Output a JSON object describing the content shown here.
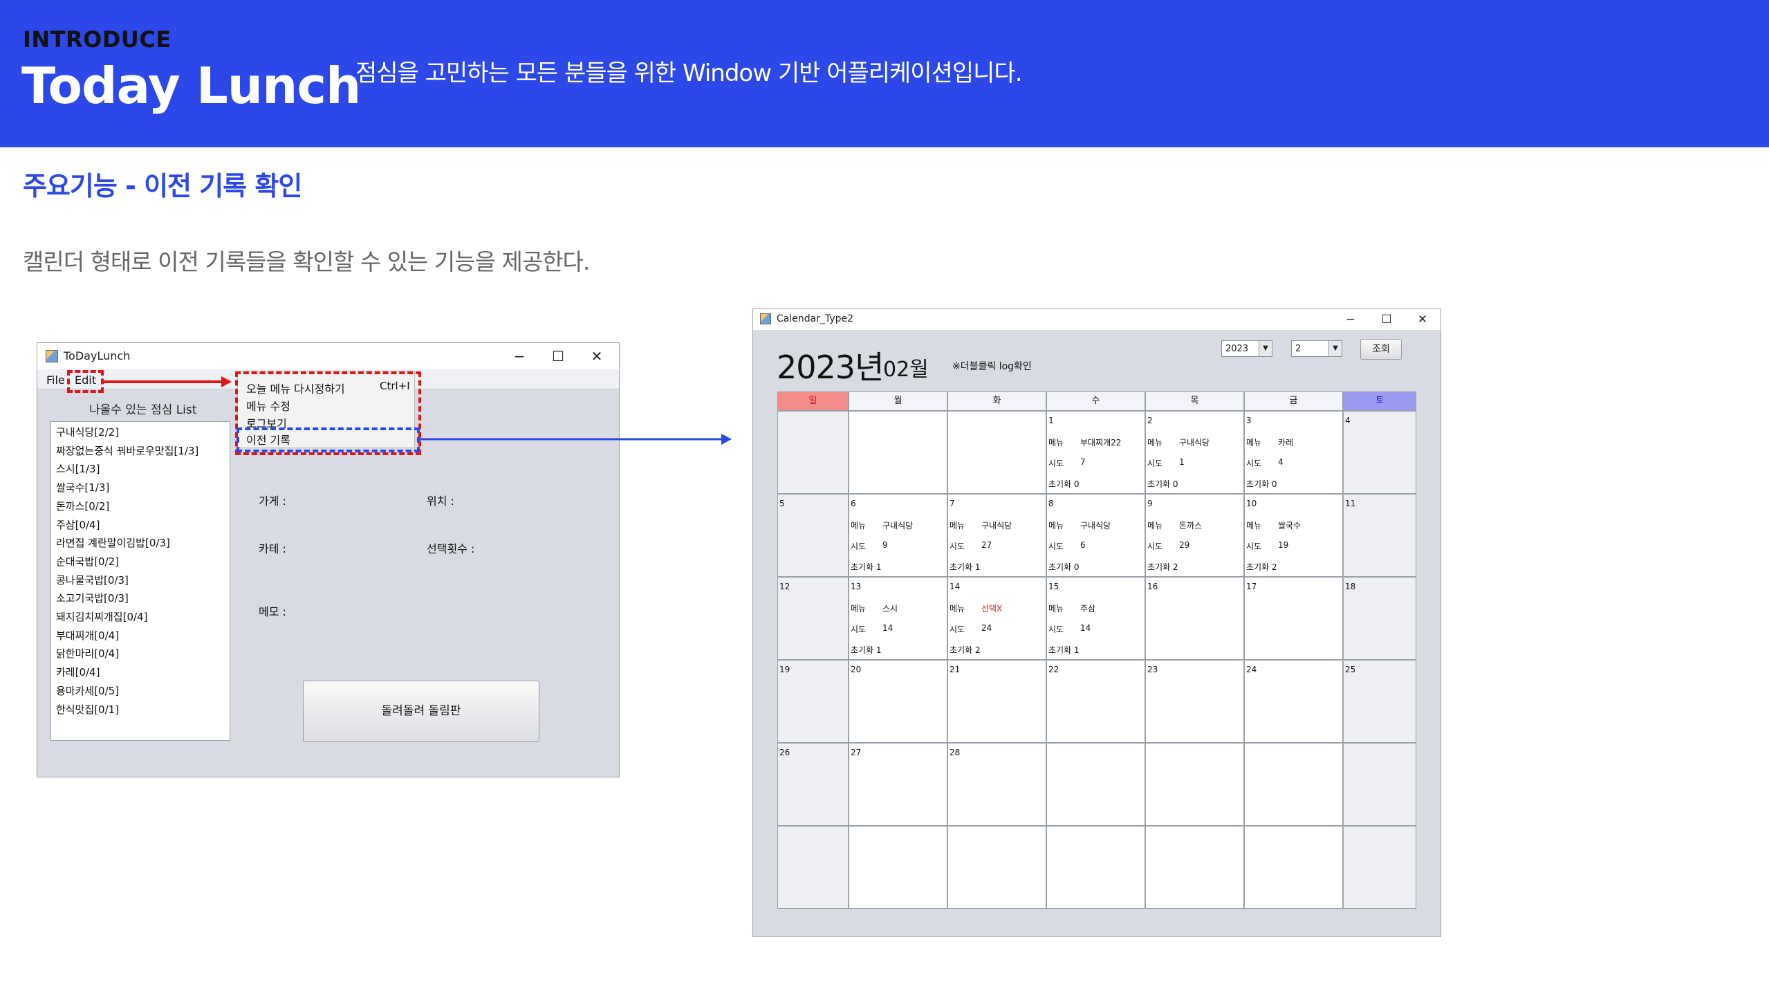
{
  "banner": {
    "intro": "INTRODUCE",
    "title": "Today Lunch",
    "description": "점심을 고민하는 모든 분들을 위한 Window 기반 어플리케이션입니다."
  },
  "section": {
    "title": "주요기능 - 이전 기록 확인",
    "description": "캘린더 형태로 이전 기록들을 확인할 수 있는 기능을 제공한다."
  },
  "lunch_window": {
    "title": "ToDayLunch",
    "menu": {
      "file": "File",
      "edit": "Edit"
    },
    "edit_menu": {
      "items": [
        "오늘 메뉴 다시정하기",
        "메뉴 수정",
        "로그보기",
        "이전 기록"
      ],
      "shortcut": "Ctrl+I"
    },
    "list_title": "나올수 있는 점심 List",
    "restaurants": [
      "구내식당[2/2]",
      "짜장없는중식 꿔바로우맛집[1/3]",
      "스시[1/3]",
      "쌀국수[1/3]",
      "돈까스[0/2]",
      "주삼[0/4]",
      "라면집 계란말이김밥[0/3]",
      "순대국밥[0/2]",
      "콩나물국밥[0/3]",
      "소고기국밥[0/3]",
      "돼지김치찌개집[0/4]",
      "부대찌개[0/4]",
      "닭한마리[0/4]",
      "카레[0/4]",
      "용마카세[0/5]",
      "한식맛집[0/1]"
    ],
    "labels": {
      "store": "가게 :",
      "location": "위치 :",
      "category": "카테 :",
      "count": "선택횟수 :",
      "memo": "메모 :"
    },
    "spin_button": "돌려돌려 돌림판"
  },
  "calendar_window": {
    "title": "Calendar_Type2",
    "year": "2023년",
    "month": "02월",
    "note": "※더블클릭 log확인",
    "year_select": "2023",
    "month_select": "2",
    "query_button": "조회",
    "weekdays": [
      "일",
      "월",
      "화",
      "수",
      "목",
      "금",
      "토"
    ],
    "labels": {
      "menu": "메뉴",
      "attempt": "시도",
      "reset": "초기화"
    },
    "days": [
      {
        "d": "1",
        "menu": "부대찌개22",
        "try": "7",
        "reset": "0"
      },
      {
        "d": "2",
        "menu": "구내식당",
        "try": "1",
        "reset": "0"
      },
      {
        "d": "3",
        "menu": "카레",
        "try": "4",
        "reset": "0"
      },
      {
        "d": "4"
      },
      {
        "d": "5"
      },
      {
        "d": "6",
        "menu": "구내식당",
        "try": "9",
        "reset": "1"
      },
      {
        "d": "7",
        "menu": "구내식당",
        "try": "27",
        "reset": "1"
      },
      {
        "d": "8",
        "menu": "구내식당",
        "try": "6",
        "reset": "0"
      },
      {
        "d": "9",
        "menu": "돈까스",
        "try": "29",
        "reset": "2"
      },
      {
        "d": "10",
        "menu": "쌀국수",
        "try": "19",
        "reset": "2"
      },
      {
        "d": "11"
      },
      {
        "d": "12"
      },
      {
        "d": "13",
        "menu": "스시",
        "try": "14",
        "reset": "1"
      },
      {
        "d": "14",
        "menu": "선택X",
        "try": "24",
        "reset": "2",
        "red": true
      },
      {
        "d": "15",
        "menu": "주삼",
        "try": "14",
        "reset": "1"
      },
      {
        "d": "16"
      },
      {
        "d": "17"
      },
      {
        "d": "18"
      },
      {
        "d": "19"
      },
      {
        "d": "20"
      },
      {
        "d": "21"
      },
      {
        "d": "22"
      },
      {
        "d": "23"
      },
      {
        "d": "24"
      },
      {
        "d": "25"
      },
      {
        "d": "26"
      },
      {
        "d": "27"
      },
      {
        "d": "28"
      }
    ],
    "colors": {
      "sunday": "#f28b8b",
      "saturday": "#9b9bf2"
    }
  }
}
